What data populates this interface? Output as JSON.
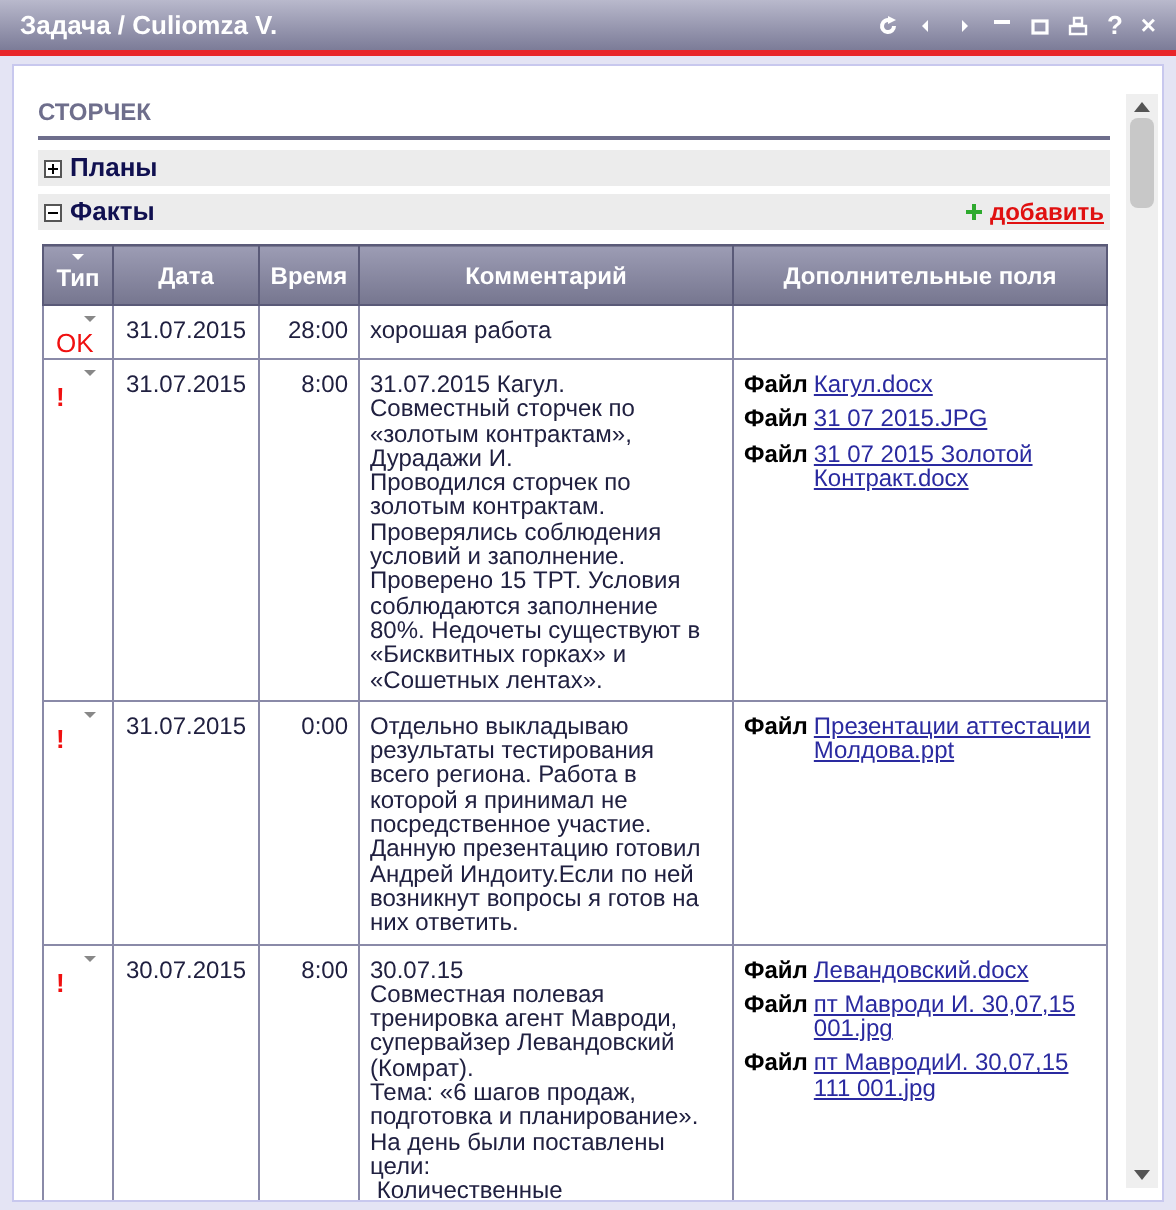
{
  "window": {
    "title": "Задача / Culiomza V.",
    "controls": [
      "?",
      "×"
    ]
  },
  "section": {
    "title": "СТОРЧЕК"
  },
  "groups": [
    {
      "label": "Планы",
      "expanded": false
    },
    {
      "label": "Факты",
      "expanded": true,
      "action": "добавить"
    }
  ],
  "table": {
    "columns": [
      "Тип",
      "Дата",
      "Время",
      "Комментарий",
      "Дополнительные поля"
    ],
    "rows": [
      {
        "kind": "ok",
        "type_label": "OK",
        "date": "31.07.2015",
        "time": "28:00",
        "comment": "хорошая работа",
        "files": []
      },
      {
        "kind": "alert",
        "type_label": "!",
        "date": "31.07.2015",
        "time": "8:00",
        "comment": "31.07.2015 Кагул.\nСовместный сторчек по\n«золотым контрактам»,\nДурадажи И.\nПроводился сторчек по\nзолотым контрактам.\nПроверялись соблюдения\nусловий и заполнение.\nПроверено 15 ТРТ. Условия\nсоблюдаются заполнение\n80%. Недочеты существуют в\n«Бисквитных горках» и\n«Сошетных лентах».",
        "files": [
          {
            "label": "Файл",
            "name": "Кагул.docx"
          },
          {
            "label": "Файл",
            "name": "31 07 2015.JPG"
          },
          {
            "label": "Файл",
            "name": "31 07 2015 Золотой Контракт.docx"
          }
        ]
      },
      {
        "kind": "alert",
        "type_label": "!",
        "date": "31.07.2015",
        "time": "0:00",
        "comment": "Отдельно выкладываю\nрезультаты тестирования\nвсего региона. Работа в\nкоторой я принимал не\nпосредственное участие.\nДанную презентацию готовил\nАндрей Индоиту.Если по ней\nвозникнут вопросы я готов на\nних ответить.",
        "files": [
          {
            "label": "Файл",
            "name": "Презентации аттестации Молдова.ppt"
          }
        ]
      },
      {
        "kind": "alert",
        "type_label": "!",
        "date": "30.07.2015",
        "time": "8:00",
        "comment": "30.07.15\nСовместная полевая\nтренировка агент Мавроди,\nсупервайзер Левандовский\n(Комрат).\nТема: «6 шагов продаж,\nподготовка и планирование».\nНа день были поставлены\nцели:\n Количественные",
        "files": [
          {
            "label": "Файл",
            "name": "Левандовский.docx"
          },
          {
            "label": "Файл",
            "name": "пт Мавроди И. 30,07,15 001.jpg"
          },
          {
            "label": "Файл",
            "name": "пт МавродиИ. 30,07,15 111 001.jpg"
          }
        ]
      }
    ]
  }
}
